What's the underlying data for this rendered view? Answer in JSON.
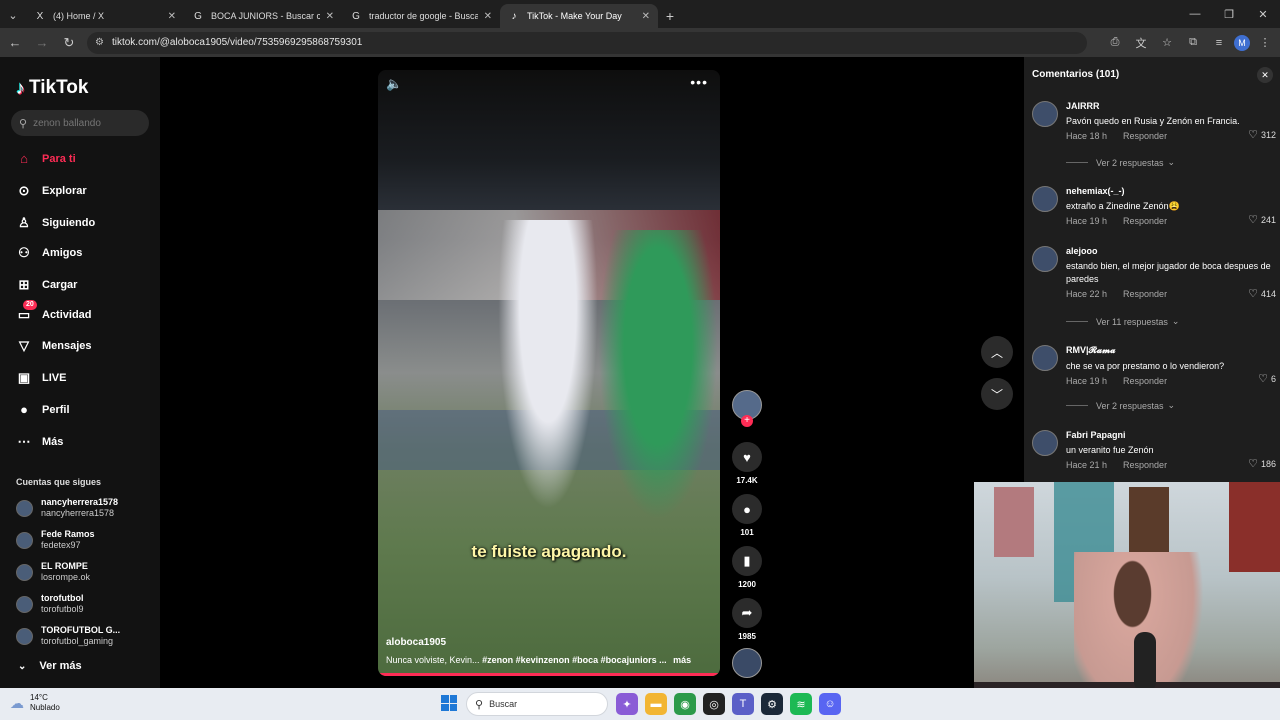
{
  "browser": {
    "tabs": [
      {
        "title": "(4) Home / X",
        "favicon": "X",
        "active": false
      },
      {
        "title": "BOCA JUNIORS - Buscar con Google",
        "favicon": "G",
        "active": false
      },
      {
        "title": "traductor de google - Buscar con Google",
        "favicon": "G",
        "active": false
      },
      {
        "title": "TikTok - Make Your Day",
        "favicon": "♪",
        "active": true
      }
    ],
    "url": "tiktok.com/@aloboca1905/video/7535969295868759301",
    "profile_initial": "M"
  },
  "sidebar": {
    "logo": "TikTok",
    "search_placeholder": "zenon ballando",
    "nav": [
      {
        "label": "Para ti",
        "icon": "home-icon",
        "glyph": "⌂",
        "active": true
      },
      {
        "label": "Explorar",
        "icon": "compass-icon",
        "glyph": "⊙"
      },
      {
        "label": "Siguiendo",
        "icon": "following-icon",
        "glyph": "♙"
      },
      {
        "label": "Amigos",
        "icon": "friends-icon",
        "glyph": "⚇"
      },
      {
        "label": "Cargar",
        "icon": "upload-icon",
        "glyph": "⊞"
      },
      {
        "label": "Actividad",
        "icon": "activity-icon",
        "glyph": "▭",
        "badge": "20"
      },
      {
        "label": "Mensajes",
        "icon": "messages-icon",
        "glyph": "▽"
      },
      {
        "label": "LIVE",
        "icon": "live-icon",
        "glyph": "▣"
      },
      {
        "label": "Perfil",
        "icon": "profile-icon",
        "glyph": "●"
      },
      {
        "label": "Más",
        "icon": "more-icon",
        "glyph": "⋯"
      }
    ],
    "following_title": "Cuentas que sigues",
    "following": [
      {
        "name": "nancyherrera1578",
        "handle": "nancyherrera1578"
      },
      {
        "name": "Fede Ramos",
        "handle": "fedetex97"
      },
      {
        "name": "EL ROMPE",
        "handle": "losrompe.ok"
      },
      {
        "name": "torofutbol",
        "handle": "torofutbol9"
      },
      {
        "name": "TOROFUTBOL G...",
        "handle": "torofutbol_gaming"
      }
    ],
    "see_more": "Ver más"
  },
  "video": {
    "caption": "te fuiste apagando.",
    "author": "aloboca1905",
    "desc_text": "Nunca volviste, Kevin...",
    "desc_tags": "#zenon  #kevinzenon  #boca  #bocajuniors ...",
    "desc_more": "más",
    "likes": "17.4K",
    "comments": "101",
    "saves": "1200",
    "shares": "1985"
  },
  "comments_panel": {
    "header": "Comentarios (101)",
    "reply_label": "Responder",
    "items": [
      {
        "user": "JAIRRR",
        "text": "Pavón quedo en Rusia y Zenón en Francia.",
        "time": "Hace 18 h",
        "likes": "312",
        "replies": "Ver 2 respuestas"
      },
      {
        "user": "nehemiax(-_-)",
        "text": "extraño a Zinedine Zenón😩",
        "time": "Hace 19 h",
        "likes": "241"
      },
      {
        "user": "alejooo",
        "text": "estando bien, el mejor jugador de boca despues de paredes",
        "time": "Hace 22 h",
        "likes": "414",
        "replies": "Ver 11 respuestas"
      },
      {
        "user": "RMV|𝓡𝓪𝓶𝓪",
        "text": "che se va por prestamo o lo vendieron?",
        "time": "Hace 19 h",
        "likes": "6",
        "replies": "Ver 2 respuestas"
      },
      {
        "user": "Fabri Papagni",
        "text": "un veranito fue Zenón",
        "time": "Hace 21 h",
        "likes": "186"
      }
    ]
  },
  "taskbar": {
    "temp": "14°C",
    "weather": "Nublado",
    "search_label": "Buscar"
  },
  "colors": {
    "accent": "#fe2c55",
    "panel": "#1e1e1e",
    "caption": "#fff7a8"
  }
}
